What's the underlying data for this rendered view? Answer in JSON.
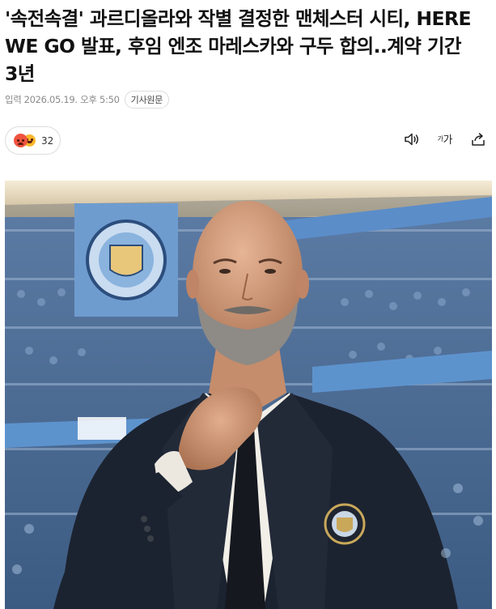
{
  "article": {
    "headline": "'속전속결' 과르디올라와 작별 결정한 맨체스터 시티, HERE WE GO 발표, 후임 엔조 마레스카와 구두 합의..계약 기간 3년",
    "meta": {
      "label": "입력",
      "date": "2026.05.19. 오후 5:50",
      "source_button": "기사원문"
    },
    "reactions": {
      "count": "32",
      "emojis": [
        "angry-emoji",
        "laugh-emoji"
      ]
    },
    "tools": {
      "audio": "speaker-icon",
      "font_size": {
        "small": "가",
        "large": "가"
      },
      "share": "share-icon"
    },
    "photo": {
      "subject": "man-in-dark-suit-adjusting-tie",
      "badge_icon": "club-crest-icon"
    }
  },
  "colors": {
    "text": "#111111",
    "meta": "#8a8a8a",
    "border": "#dcdcdc",
    "angry": "#f0533e",
    "laugh": "#f9b72b"
  }
}
